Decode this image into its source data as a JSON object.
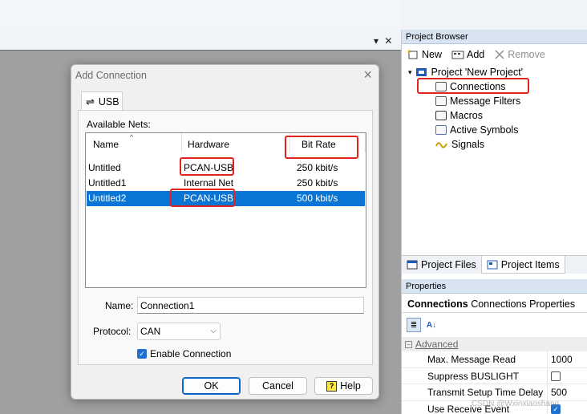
{
  "workspace": {
    "doc_controls": {
      "menu_glyph": "▾",
      "close_glyph": "✕"
    }
  },
  "project_browser": {
    "title": "Project Browser",
    "toolbar": {
      "new_label": "New",
      "add_label": "Add",
      "remove_label": "Remove"
    },
    "tree": {
      "root": "Project 'New Project'",
      "items": [
        "Connections",
        "Message Filters",
        "Macros",
        "Active Symbols",
        "Signals"
      ]
    },
    "tabs": [
      "Project Files",
      "Project Items"
    ]
  },
  "properties": {
    "title": "Properties",
    "selected_object": "Connections",
    "selected_type": "Connections Properties",
    "category": "Advanced",
    "rows": [
      {
        "name": "Max. Message Read",
        "value": "1000",
        "type": "text"
      },
      {
        "name": "Suppress BUSLIGHT",
        "value": "",
        "type": "checkbox",
        "checked": false
      },
      {
        "name": "Transmit Setup Time Delay",
        "value": "500",
        "type": "text"
      },
      {
        "name": "Use Receive Event",
        "value": "",
        "type": "checkbox",
        "checked": true
      }
    ]
  },
  "dialog": {
    "title": "Add Connection",
    "tab": "USB",
    "available_nets_label": "Available Nets:",
    "columns": [
      "Name",
      "Hardware",
      "Bit Rate"
    ],
    "nets": [
      {
        "name": "Untitled",
        "hardware": "PCAN-USB",
        "bitrate": "250 kbit/s",
        "selected": false
      },
      {
        "name": "Untitled1",
        "hardware": "Internal Net",
        "bitrate": "250 kbit/s",
        "selected": false
      },
      {
        "name": "Untitled2",
        "hardware": "PCAN-USB",
        "bitrate": "500 kbit/s",
        "selected": true
      }
    ],
    "name_label": "Name:",
    "name_value": "Connection1",
    "protocol_label": "Protocol:",
    "protocol_value": "CAN",
    "enable_label": "Enable Connection",
    "enable_checked": true,
    "ok_label": "OK",
    "cancel_label": "Cancel",
    "help_label": "Help"
  },
  "watermark": "CSDN @Wxinxiaoshang",
  "colors": {
    "highlight_red": "#e2241d",
    "selection_blue": "#0b75d6",
    "panel_header": "#d8e4f2"
  }
}
